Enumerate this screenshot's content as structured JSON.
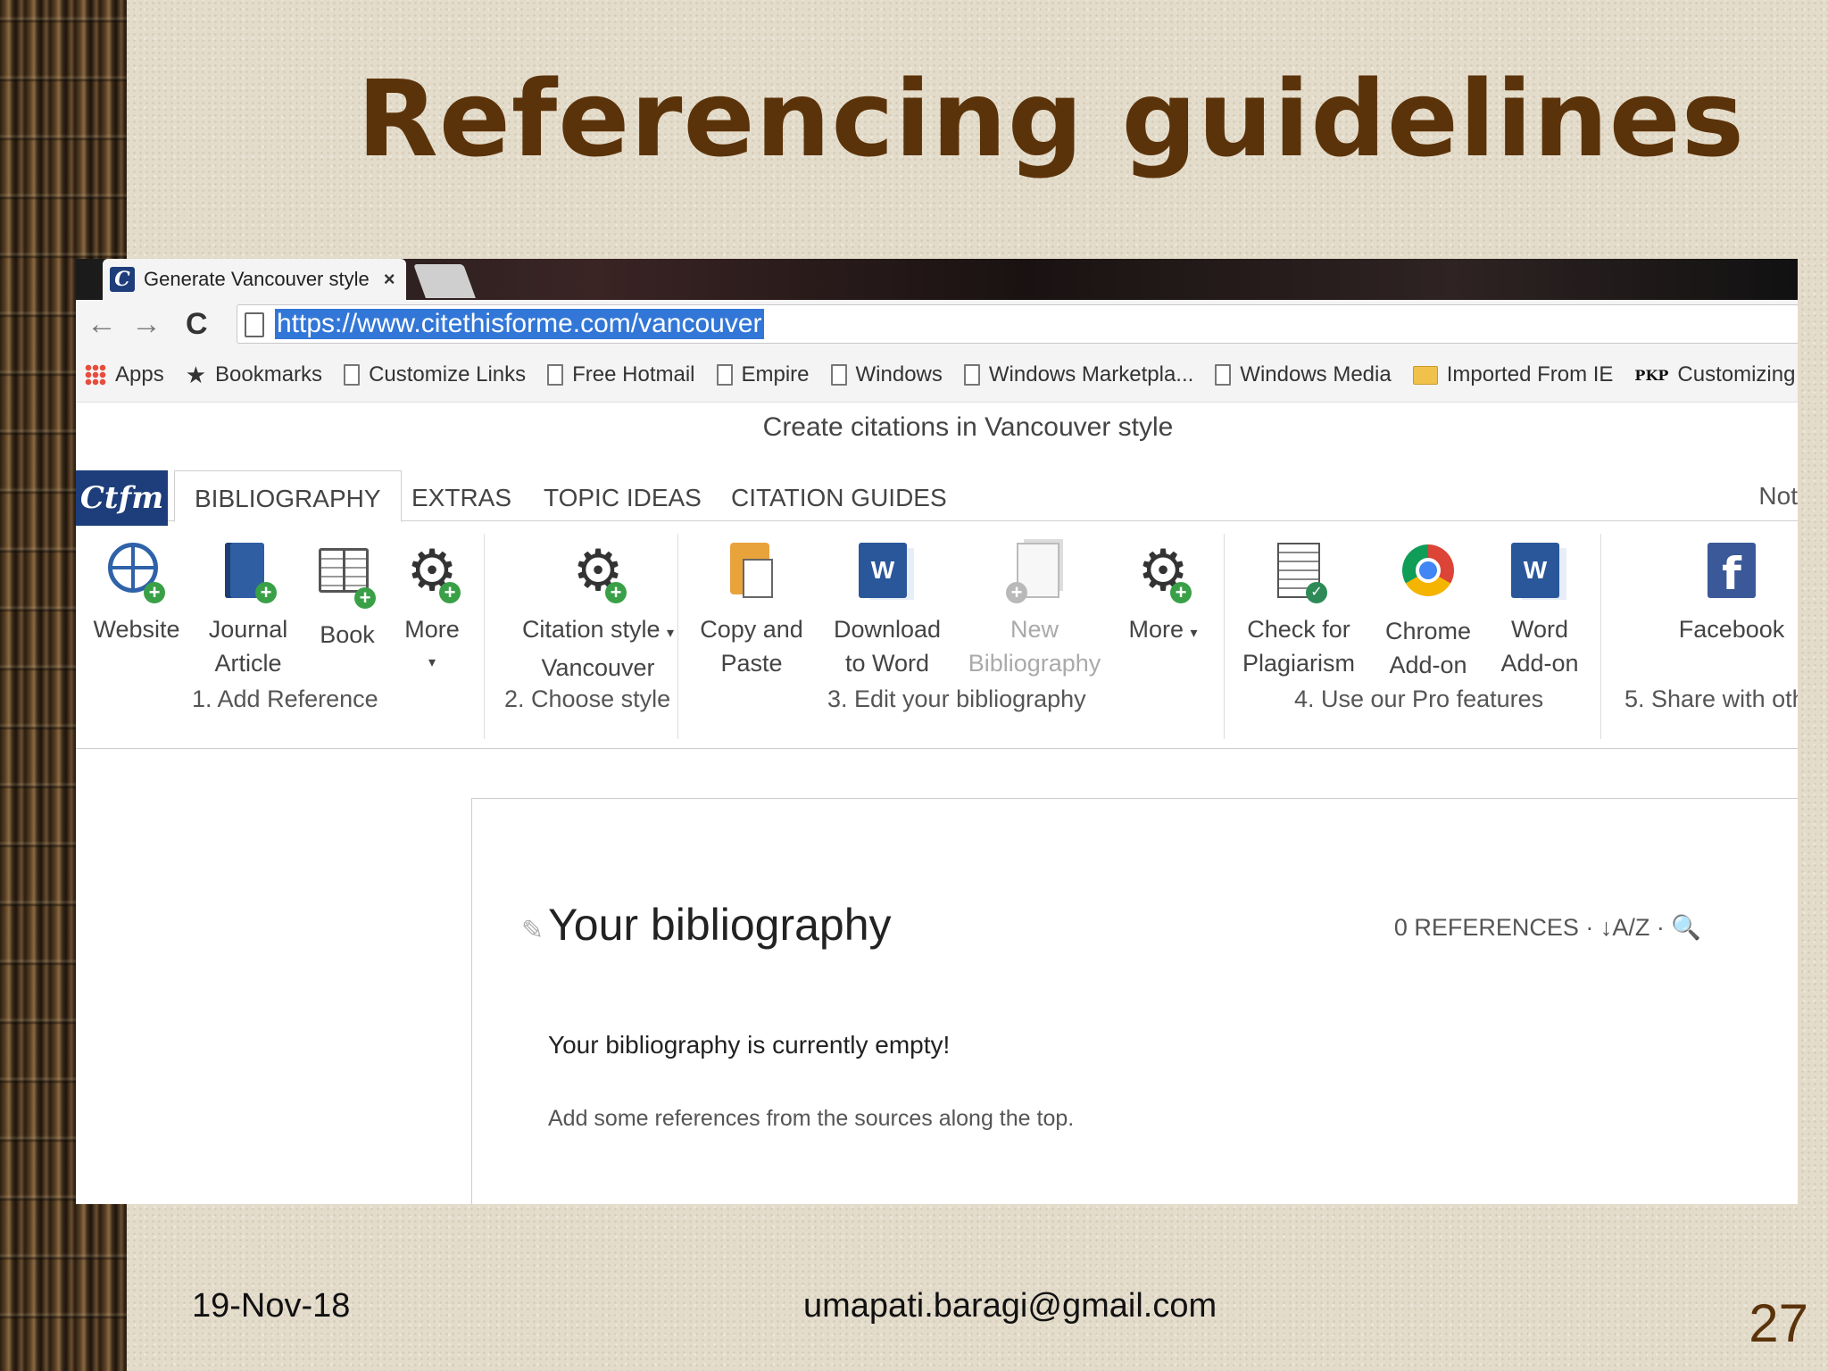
{
  "slide": {
    "title": "Referencing guidelines",
    "date": "19-Nov-18",
    "email": "umapati.baragi@gmail.com",
    "page_number": "27"
  },
  "browser": {
    "tab_title": "Generate Vancouver style",
    "tab_close": "×",
    "favicon": "C",
    "back_icon": "←",
    "forward_icon": "→",
    "reload_icon": "C",
    "url": "https://www.citethisforme.com/vancouver",
    "bookmarks": [
      {
        "label": "Apps",
        "icon": "apps-grid-icon"
      },
      {
        "label": "Bookmarks",
        "icon": "star-icon"
      },
      {
        "label": "Customize Links",
        "icon": "page-icon"
      },
      {
        "label": "Free Hotmail",
        "icon": "page-icon"
      },
      {
        "label": "Empire",
        "icon": "page-icon"
      },
      {
        "label": "Windows",
        "icon": "page-icon"
      },
      {
        "label": "Windows Marketpla...",
        "icon": "page-icon"
      },
      {
        "label": "Windows Media",
        "icon": "page-icon"
      },
      {
        "label": "Imported From IE",
        "icon": "folder-icon"
      },
      {
        "label": "Customizing OJ",
        "icon": "pkp-icon"
      }
    ],
    "pkp_text": "PKP",
    "star_glyph": "★"
  },
  "site": {
    "header": "Create citations in Vancouver style",
    "logo": "Ctfm",
    "tabs": [
      "BIBLIOGRAPHY",
      "EXTRAS",
      "TOPIC IDEAS",
      "CITATION GUIDES"
    ],
    "not_link": "Not",
    "ribbon": {
      "website": "Website",
      "journal_1": "Journal",
      "journal_2": "Article",
      "book": "Book",
      "more": "More",
      "more_caret": "▾",
      "citation_style_1": "Citation style",
      "citation_style_2": "Vancouver",
      "copy_1": "Copy and",
      "copy_2": "Paste",
      "download_1": "Download",
      "download_2": "to Word",
      "new_1": "New",
      "new_2": "Bibliography",
      "more2": "More",
      "check_1": "Check for",
      "check_2": "Plagiarism",
      "chrome_1": "Chrome",
      "chrome_2": "Add-on",
      "word_1": "Word",
      "word_2": "Add-on",
      "facebook": "Facebook",
      "plus": "+",
      "checkmark": "✓",
      "gear_glyph": "⚙",
      "word_letter": "W",
      "fb_letter": "f"
    },
    "groups": [
      "1. Add Reference",
      "2. Choose style",
      "3. Edit your bibliography",
      "4. Use our Pro features",
      "5. Share with oth"
    ],
    "bibliography": {
      "pencil": "✎",
      "title": "Your bibliography",
      "ref_count": "0 REFERENCES · ↓A/Z · 🔍",
      "empty_msg": "Your bibliography is currently empty!",
      "hint": "Add some references from the sources along the top."
    }
  }
}
